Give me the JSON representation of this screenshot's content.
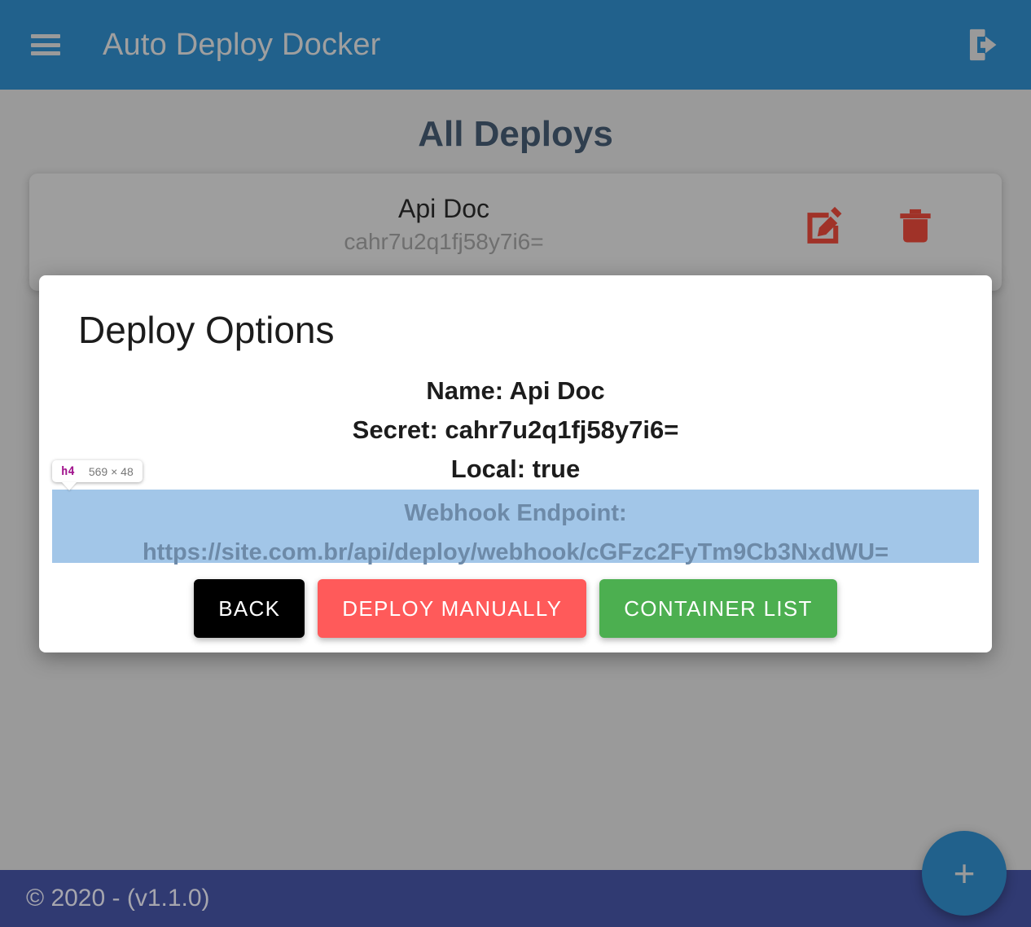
{
  "header": {
    "title": "Auto Deploy Docker",
    "menu_icon": "hamburger-menu-icon",
    "logout_icon": "logout-icon",
    "background_color": "#21618c"
  },
  "main": {
    "page_title": "All Deploys",
    "deploy_card": {
      "name": "Api Doc",
      "secret": "cahr7u2q1fj58y7i6=",
      "edit_icon": "edit-pencil-icon",
      "delete_icon": "trash-icon",
      "icon_color": "#a03228"
    },
    "fab_label": "+"
  },
  "modal": {
    "title": "Deploy Options",
    "info_lines": [
      "Name: Api Doc",
      "Secret: cahr7u2q1fj58y7i6=",
      "Local: true"
    ],
    "webhook": {
      "label": "Webhook Endpoint:",
      "url": "https://site.com.br/api/deploy/webhook/cGFzc2FyTm9Cb3NxdWU=",
      "highlight_color": "#a2c6e8"
    },
    "buttons": {
      "back": "BACK",
      "deploy_manually": "DEPLOY MANUALLY",
      "container_list": "CONTAINER LIST",
      "back_color": "#000000",
      "deploy_color": "#ff5a5a",
      "container_color": "#4caf50"
    }
  },
  "inspector": {
    "tag": "h4",
    "dimensions": "569 × 48"
  },
  "footer": {
    "copyright": "© 2020 - (v1.1.0)",
    "background_color": "#303a72"
  }
}
